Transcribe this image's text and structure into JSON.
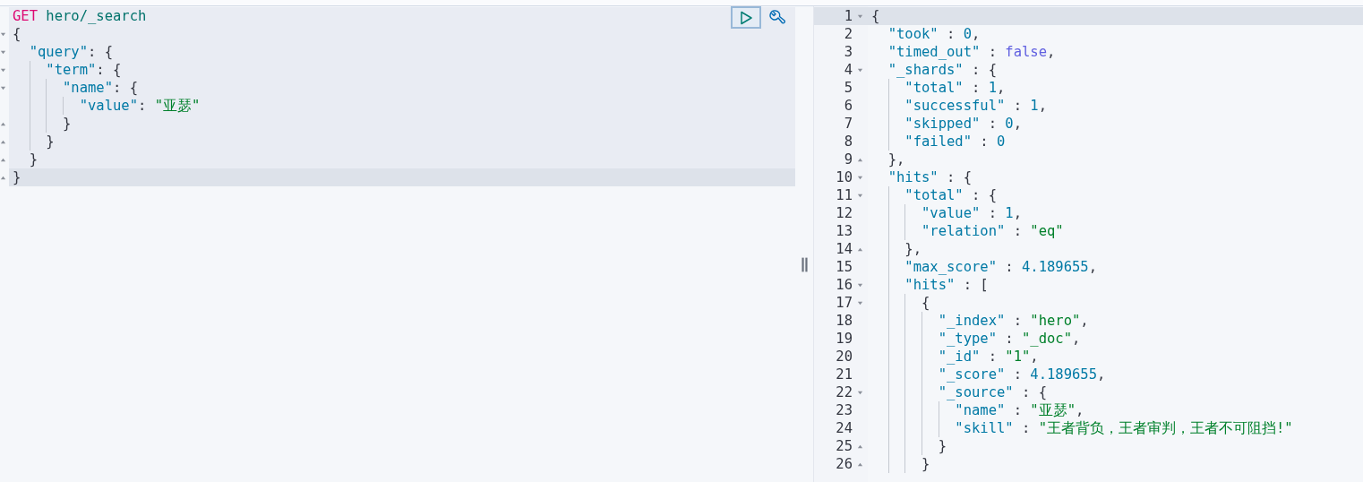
{
  "request": {
    "lines": [
      {
        "active": false,
        "tokens": [
          {
            "kind": "method",
            "s": "GET"
          },
          {
            "kind": "url",
            "s": " hero/_search"
          }
        ]
      },
      {
        "fold_start": true,
        "active": false,
        "tokens": [
          {
            "kind": "punct",
            "s": "{"
          }
        ]
      },
      {
        "fold_start": true,
        "active": false,
        "tokens": [
          {
            "kind": "key",
            "s": "  \"query\""
          },
          {
            "kind": "punct",
            "s": ": {"
          }
        ]
      },
      {
        "fold_start": true,
        "active": false,
        "tokens": [
          {
            "kind": "key",
            "s": "    \"term\""
          },
          {
            "kind": "punct",
            "s": ": {"
          }
        ]
      },
      {
        "fold_start": true,
        "active": false,
        "tokens": [
          {
            "kind": "key",
            "s": "      \"name\""
          },
          {
            "kind": "punct",
            "s": ": {"
          }
        ]
      },
      {
        "active": false,
        "tokens": [
          {
            "kind": "key",
            "s": "        \"value\""
          },
          {
            "kind": "punct",
            "s": ": "
          },
          {
            "kind": "string",
            "s": "\"亚瑟\""
          }
        ]
      },
      {
        "fold_end": true,
        "active": false,
        "tokens": [
          {
            "kind": "punct",
            "s": "      }"
          }
        ]
      },
      {
        "fold_end": true,
        "active": false,
        "tokens": [
          {
            "kind": "punct",
            "s": "    }"
          }
        ]
      },
      {
        "fold_end": true,
        "active": false,
        "tokens": [
          {
            "kind": "punct",
            "s": "  }"
          }
        ]
      },
      {
        "fold_end": true,
        "active": true,
        "tokens": [
          {
            "kind": "punct",
            "s": "}"
          }
        ]
      }
    ]
  },
  "response": {
    "lines": [
      {
        "number": "1",
        "fold_start": true,
        "active": true,
        "tokens": [
          {
            "kind": "punct",
            "s": "{"
          }
        ]
      },
      {
        "number": "2",
        "active": false,
        "tokens": [
          {
            "kind": "key",
            "s": "  \"took\""
          },
          {
            "kind": "punct",
            "s": " : "
          },
          {
            "kind": "number",
            "s": "0"
          },
          {
            "kind": "punct",
            "s": ","
          }
        ]
      },
      {
        "number": "3",
        "active": false,
        "tokens": [
          {
            "kind": "key",
            "s": "  \"timed_out\""
          },
          {
            "kind": "punct",
            "s": " : "
          },
          {
            "kind": "bool",
            "s": "false"
          },
          {
            "kind": "punct",
            "s": ","
          }
        ]
      },
      {
        "number": "4",
        "fold_start": true,
        "active": false,
        "tokens": [
          {
            "kind": "key",
            "s": "  \"_shards\""
          },
          {
            "kind": "punct",
            "s": " : {"
          }
        ]
      },
      {
        "number": "5",
        "active": false,
        "tokens": [
          {
            "kind": "key",
            "s": "    \"total\""
          },
          {
            "kind": "punct",
            "s": " : "
          },
          {
            "kind": "number",
            "s": "1"
          },
          {
            "kind": "punct",
            "s": ","
          }
        ]
      },
      {
        "number": "6",
        "active": false,
        "tokens": [
          {
            "kind": "key",
            "s": "    \"successful\""
          },
          {
            "kind": "punct",
            "s": " : "
          },
          {
            "kind": "number",
            "s": "1"
          },
          {
            "kind": "punct",
            "s": ","
          }
        ]
      },
      {
        "number": "7",
        "active": false,
        "tokens": [
          {
            "kind": "key",
            "s": "    \"skipped\""
          },
          {
            "kind": "punct",
            "s": " : "
          },
          {
            "kind": "number",
            "s": "0"
          },
          {
            "kind": "punct",
            "s": ","
          }
        ]
      },
      {
        "number": "8",
        "active": false,
        "tokens": [
          {
            "kind": "key",
            "s": "    \"failed\""
          },
          {
            "kind": "punct",
            "s": " : "
          },
          {
            "kind": "number",
            "s": "0"
          }
        ]
      },
      {
        "number": "9",
        "fold_end": true,
        "active": false,
        "tokens": [
          {
            "kind": "punct",
            "s": "  },"
          }
        ]
      },
      {
        "number": "10",
        "fold_start": true,
        "active": false,
        "tokens": [
          {
            "kind": "key",
            "s": "  \"hits\""
          },
          {
            "kind": "punct",
            "s": " : {"
          }
        ]
      },
      {
        "number": "11",
        "fold_start": true,
        "active": false,
        "tokens": [
          {
            "kind": "key",
            "s": "    \"total\""
          },
          {
            "kind": "punct",
            "s": " : {"
          }
        ]
      },
      {
        "number": "12",
        "active": false,
        "tokens": [
          {
            "kind": "key",
            "s": "      \"value\""
          },
          {
            "kind": "punct",
            "s": " : "
          },
          {
            "kind": "number",
            "s": "1"
          },
          {
            "kind": "punct",
            "s": ","
          }
        ]
      },
      {
        "number": "13",
        "active": false,
        "tokens": [
          {
            "kind": "key",
            "s": "      \"relation\""
          },
          {
            "kind": "punct",
            "s": " : "
          },
          {
            "kind": "string",
            "s": "\"eq\""
          }
        ]
      },
      {
        "number": "14",
        "fold_end": true,
        "active": false,
        "tokens": [
          {
            "kind": "punct",
            "s": "    },"
          }
        ]
      },
      {
        "number": "15",
        "active": false,
        "tokens": [
          {
            "kind": "key",
            "s": "    \"max_score\""
          },
          {
            "kind": "punct",
            "s": " : "
          },
          {
            "kind": "number",
            "s": "4.189655"
          },
          {
            "kind": "punct",
            "s": ","
          }
        ]
      },
      {
        "number": "16",
        "fold_start": true,
        "active": false,
        "tokens": [
          {
            "kind": "key",
            "s": "    \"hits\""
          },
          {
            "kind": "punct",
            "s": " : ["
          }
        ]
      },
      {
        "number": "17",
        "fold_start": true,
        "active": false,
        "tokens": [
          {
            "kind": "punct",
            "s": "      {"
          }
        ]
      },
      {
        "number": "18",
        "active": false,
        "tokens": [
          {
            "kind": "key",
            "s": "        \"_index\""
          },
          {
            "kind": "punct",
            "s": " : "
          },
          {
            "kind": "string",
            "s": "\"hero\""
          },
          {
            "kind": "punct",
            "s": ","
          }
        ]
      },
      {
        "number": "19",
        "active": false,
        "tokens": [
          {
            "kind": "key",
            "s": "        \"_type\""
          },
          {
            "kind": "punct",
            "s": " : "
          },
          {
            "kind": "string",
            "s": "\"_doc\""
          },
          {
            "kind": "punct",
            "s": ","
          }
        ]
      },
      {
        "number": "20",
        "active": false,
        "tokens": [
          {
            "kind": "key",
            "s": "        \"_id\""
          },
          {
            "kind": "punct",
            "s": " : "
          },
          {
            "kind": "string",
            "s": "\"1\""
          },
          {
            "kind": "punct",
            "s": ","
          }
        ]
      },
      {
        "number": "21",
        "active": false,
        "tokens": [
          {
            "kind": "key",
            "s": "        \"_score\""
          },
          {
            "kind": "punct",
            "s": " : "
          },
          {
            "kind": "number",
            "s": "4.189655"
          },
          {
            "kind": "punct",
            "s": ","
          }
        ]
      },
      {
        "number": "22",
        "fold_start": true,
        "active": false,
        "tokens": [
          {
            "kind": "key",
            "s": "        \"_source\""
          },
          {
            "kind": "punct",
            "s": " : {"
          }
        ]
      },
      {
        "number": "23",
        "active": false,
        "tokens": [
          {
            "kind": "key",
            "s": "          \"name\""
          },
          {
            "kind": "punct",
            "s": " : "
          },
          {
            "kind": "string",
            "s": "\"亚瑟\""
          },
          {
            "kind": "punct",
            "s": ","
          }
        ]
      },
      {
        "number": "24",
        "active": false,
        "tokens": [
          {
            "kind": "key",
            "s": "          \"skill\""
          },
          {
            "kind": "punct",
            "s": " : "
          },
          {
            "kind": "string",
            "s": "\"王者背负，王者审判，王者不可阻挡!\""
          }
        ]
      },
      {
        "number": "25",
        "fold_end": true,
        "active": false,
        "tokens": [
          {
            "kind": "punct",
            "s": "        }"
          }
        ]
      },
      {
        "number": "26",
        "fold_end": true,
        "active": false,
        "tokens": [
          {
            "kind": "punct",
            "s": "      }"
          }
        ]
      }
    ]
  }
}
